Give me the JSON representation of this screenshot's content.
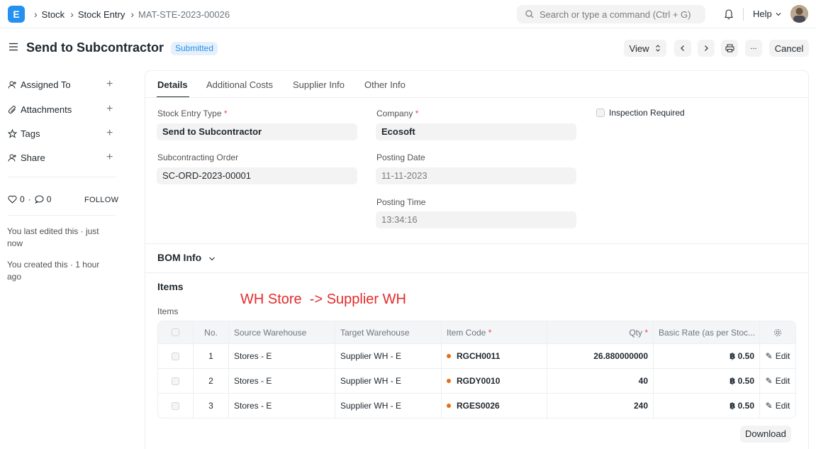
{
  "navbar": {
    "logo_letter": "E",
    "breadcrumbs": [
      "Stock",
      "Stock Entry",
      "MAT-STE-2023-00026"
    ],
    "search_placeholder": "Search or type a command (Ctrl + G)",
    "help_label": "Help"
  },
  "page": {
    "title": "Send to Subcontractor",
    "status": "Submitted",
    "view_label": "View",
    "more_label": "...",
    "cancel_label": "Cancel"
  },
  "sidebar": {
    "items": [
      {
        "label": "Assigned To",
        "icon": "user-plus-icon"
      },
      {
        "label": "Attachments",
        "icon": "paperclip-icon"
      },
      {
        "label": "Tags",
        "icon": "tag-icon"
      },
      {
        "label": "Share",
        "icon": "share-icon"
      }
    ],
    "likes": "0",
    "comments": "0",
    "follow_label": "FOLLOW",
    "last_edited": "You last edited this · just now",
    "created": "You created this · 1 hour ago"
  },
  "tabs": [
    "Details",
    "Additional Costs",
    "Supplier Info",
    "Other Info"
  ],
  "form": {
    "stock_entry_type": {
      "label": "Stock Entry Type",
      "value": "Send to Subcontractor"
    },
    "company": {
      "label": "Company",
      "value": "Ecosoft"
    },
    "inspection_required": {
      "label": "Inspection Required",
      "checked": false
    },
    "subcontracting_order": {
      "label": "Subcontracting Order",
      "value": "SC-ORD-2023-00001"
    },
    "posting_date": {
      "label": "Posting Date",
      "value": "11-11-2023"
    },
    "posting_time": {
      "label": "Posting Time",
      "value": "13:34:16"
    }
  },
  "bom_section": {
    "title": "BOM Info"
  },
  "items_section": {
    "title": "Items",
    "table_label": "Items",
    "annotation": "WH Store  -> Supplier WH",
    "columns": {
      "no": "No.",
      "source": "Source Warehouse",
      "target": "Target Warehouse",
      "item_code": "Item Code",
      "qty": "Qty",
      "rate": "Basic Rate (as per Stoc..."
    },
    "rows": [
      {
        "no": "1",
        "source": "Stores - E",
        "target": "Supplier WH - E",
        "item_code": "RGCH0011",
        "qty": "26.880000000",
        "rate": "฿ 0.50",
        "edit": "Edit"
      },
      {
        "no": "2",
        "source": "Stores - E",
        "target": "Supplier WH - E",
        "item_code": "RGDY0010",
        "qty": "40",
        "rate": "฿ 0.50",
        "edit": "Edit"
      },
      {
        "no": "3",
        "source": "Stores - E",
        "target": "Supplier WH - E",
        "item_code": "RGES0026",
        "qty": "240",
        "rate": "฿ 0.50",
        "edit": "Edit"
      }
    ],
    "download_label": "Download"
  },
  "colors": {
    "accent": "#2490ef",
    "required": "#e24c4c",
    "annotation": "#e52b2b",
    "item_dot": "#e86c13"
  }
}
